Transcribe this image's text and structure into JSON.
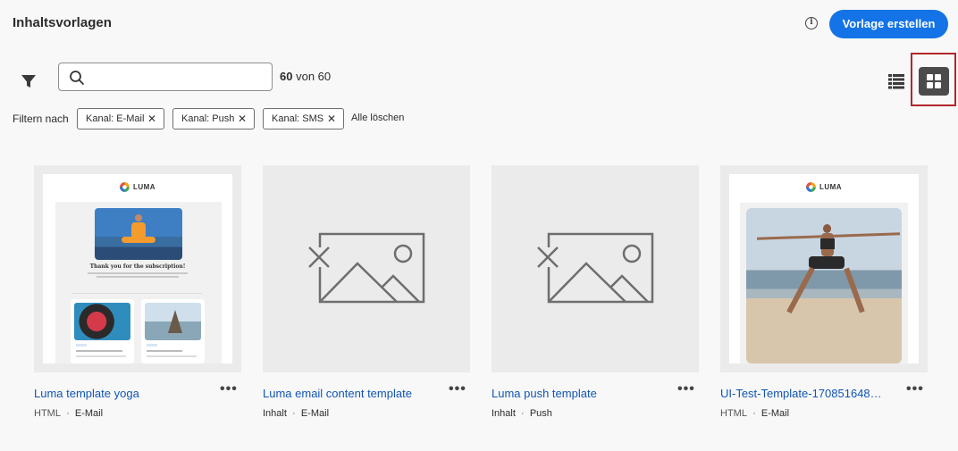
{
  "header": {
    "title": "Inhaltsvorlagen",
    "info_icon": "info-icon",
    "create_label": "Vorlage erstellen"
  },
  "toolbar": {
    "search_value": "",
    "count_number": "60",
    "count_suffix": "von 60",
    "view_mode": "grid"
  },
  "filters": {
    "label": "Filtern nach",
    "chips": [
      {
        "label": "Kanal: E-Mail"
      },
      {
        "label": "Kanal: Push"
      },
      {
        "label": "Kanal: SMS"
      }
    ],
    "clear_all": "Alle löschen"
  },
  "cards": [
    {
      "title": "Luma template yoga",
      "type": "HTML",
      "channel": "E-Mail",
      "thumbnail": "email-yoga-preview"
    },
    {
      "title": "Luma email content template",
      "type": "Inhalt",
      "channel": "E-Mail",
      "thumbnail": "placeholder-image-icon"
    },
    {
      "title": "Luma push template",
      "type": "Inhalt",
      "channel": "Push",
      "thumbnail": "placeholder-image-icon"
    },
    {
      "title": "UI-Test-Template-170851648906...",
      "type": "HTML",
      "channel": "E-Mail",
      "thumbnail": "email-yoga-pose-preview"
    }
  ],
  "preview": {
    "brand": "LUMA",
    "email_heading": "Thank you for the subscription!"
  },
  "meta_separator": "·",
  "more_label": "•••",
  "colors": {
    "accent": "#1473e6",
    "link": "#1155b6",
    "highlight": "#b3262a"
  }
}
